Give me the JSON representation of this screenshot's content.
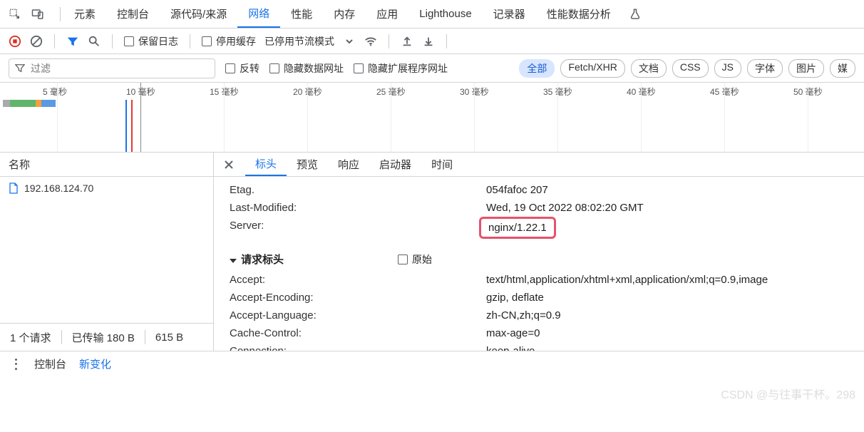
{
  "top_icons": {
    "inspect": "inspect-icon",
    "device": "device-icon"
  },
  "top_tabs": [
    {
      "label": "元素",
      "active": false
    },
    {
      "label": "控制台",
      "active": false
    },
    {
      "label": "源代码/来源",
      "active": false
    },
    {
      "label": "网络",
      "active": true
    },
    {
      "label": "性能",
      "active": false
    },
    {
      "label": "内存",
      "active": false
    },
    {
      "label": "应用",
      "active": false
    },
    {
      "label": "Lighthouse",
      "active": false
    },
    {
      "label": "记录器",
      "active": false
    },
    {
      "label": "性能数据分析",
      "active": false
    }
  ],
  "toolbar": {
    "preserve_log": "保留日志",
    "disable_cache": "停用缓存",
    "throttling": "已停用节流模式"
  },
  "filter": {
    "placeholder": "过滤",
    "invert": "反转",
    "hide_data_urls": "隐藏数据网址",
    "hide_ext_urls": "隐藏扩展程序网址",
    "types": [
      {
        "label": "全部",
        "cls": "active"
      },
      {
        "label": "Fetch/XHR",
        "cls": "outline"
      },
      {
        "label": "文档",
        "cls": "outline"
      },
      {
        "label": "CSS",
        "cls": "outline"
      },
      {
        "label": "JS",
        "cls": "outline"
      },
      {
        "label": "字体",
        "cls": "outline"
      },
      {
        "label": "图片",
        "cls": "outline"
      },
      {
        "label": "媒",
        "cls": "outline"
      }
    ]
  },
  "timeline": {
    "ticks": [
      "5 毫秒",
      "10 毫秒",
      "15 毫秒",
      "20 毫秒",
      "25 毫秒",
      "30 毫秒",
      "35 毫秒",
      "40 毫秒",
      "45 毫秒",
      "50 毫秒"
    ]
  },
  "name_header": "名称",
  "requests": [
    {
      "name": "192.168.124.70"
    }
  ],
  "detail_tabs": [
    {
      "label": "标头",
      "active": true
    },
    {
      "label": "预览",
      "active": false
    },
    {
      "label": "响应",
      "active": false
    },
    {
      "label": "启动器",
      "active": false
    },
    {
      "label": "时间",
      "active": false
    }
  ],
  "headers": {
    "truncated": {
      "k": "Etag.",
      "v": "054fafoc 207"
    },
    "last_modified": {
      "k": "Last-Modified:",
      "v": "Wed, 19 Oct 2022 08:02:20 GMT"
    },
    "server": {
      "k": "Server:",
      "v": "nginx/1.22.1"
    },
    "section": {
      "title": "请求标头",
      "raw": "原始"
    },
    "accept": {
      "k": "Accept:",
      "v": "text/html,application/xhtml+xml,application/xml;q=0.9,image"
    },
    "accept_enc": {
      "k": "Accept-Encoding:",
      "v": "gzip, deflate"
    },
    "accept_lang": {
      "k": "Accept-Language:",
      "v": "zh-CN,zh;q=0.9"
    },
    "cache_ctrl": {
      "k": "Cache-Control:",
      "v": "max-age=0"
    },
    "connection": {
      "k": "Connection:",
      "v": "keep-alive"
    }
  },
  "summary": {
    "requests": "1 个请求",
    "transferred": "已传输 180 B",
    "resources": "615 B"
  },
  "bottom": {
    "console": "控制台",
    "new": "新变化"
  },
  "watermark": "CSDN @与往事干杯。298"
}
